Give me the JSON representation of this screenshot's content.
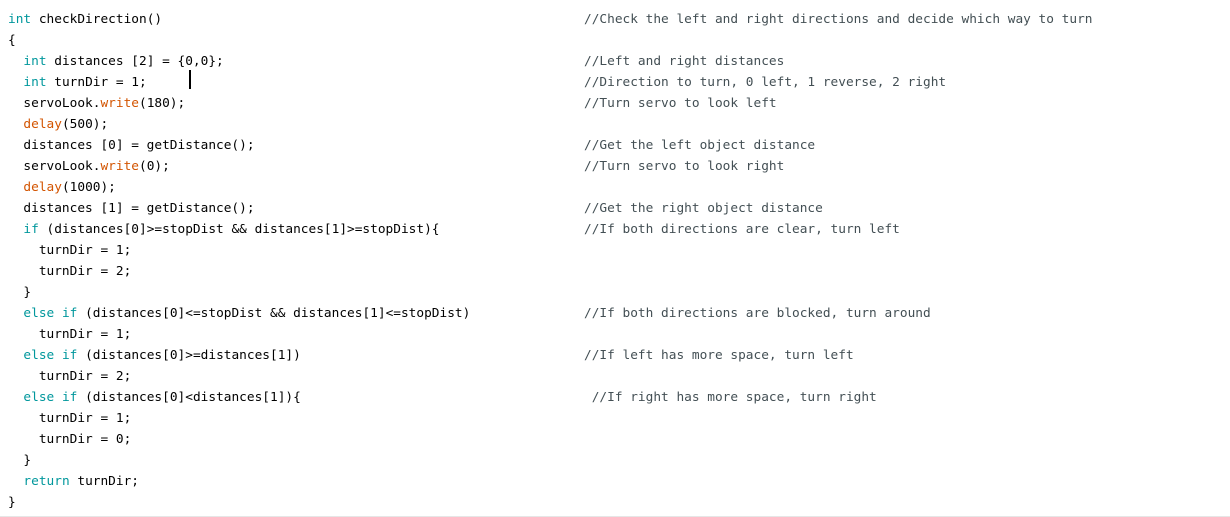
{
  "editor": {
    "lines": [
      {
        "tokens": [
          {
            "t": "int",
            "c": "kw"
          },
          {
            "t": " checkDirection()",
            "c": "plain"
          }
        ],
        "comment": "//Check the left and right directions and decide which way to turn"
      },
      {
        "tokens": [
          {
            "t": "{",
            "c": "plain"
          }
        ],
        "comment": ""
      },
      {
        "tokens": [
          {
            "t": "  ",
            "c": "plain"
          },
          {
            "t": "int",
            "c": "kw"
          },
          {
            "t": " distances [2] = {0,0};",
            "c": "plain"
          }
        ],
        "comment": "//Left and right distances"
      },
      {
        "tokens": [
          {
            "t": "  ",
            "c": "plain"
          },
          {
            "t": "int",
            "c": "kw"
          },
          {
            "t": " turnDir = 1;",
            "c": "plain"
          }
        ],
        "comment": "//Direction to turn, 0 left, 1 reverse, 2 right"
      },
      {
        "tokens": [
          {
            "t": "  servoLook.",
            "c": "plain"
          },
          {
            "t": "write",
            "c": "fn"
          },
          {
            "t": "(180);",
            "c": "plain"
          }
        ],
        "comment": "//Turn servo to look left"
      },
      {
        "tokens": [
          {
            "t": "  ",
            "c": "plain"
          },
          {
            "t": "delay",
            "c": "fn"
          },
          {
            "t": "(500);",
            "c": "plain"
          }
        ],
        "comment": ""
      },
      {
        "tokens": [
          {
            "t": "  distances [0] = getDistance();",
            "c": "plain"
          }
        ],
        "comment": "//Get the left object distance"
      },
      {
        "tokens": [
          {
            "t": "  servoLook.",
            "c": "plain"
          },
          {
            "t": "write",
            "c": "fn"
          },
          {
            "t": "(0);",
            "c": "plain"
          }
        ],
        "comment": "//Turn servo to look right"
      },
      {
        "tokens": [
          {
            "t": "  ",
            "c": "plain"
          },
          {
            "t": "delay",
            "c": "fn"
          },
          {
            "t": "(1000);",
            "c": "plain"
          }
        ],
        "comment": ""
      },
      {
        "tokens": [
          {
            "t": "  distances [1] = getDistance();",
            "c": "plain"
          }
        ],
        "comment": "//Get the right object distance"
      },
      {
        "tokens": [
          {
            "t": "  ",
            "c": "plain"
          },
          {
            "t": "if",
            "c": "kw"
          },
          {
            "t": " (distances[0]>=stopDist && distances[1]>=stopDist){",
            "c": "plain"
          }
        ],
        "comment": "//If both directions are clear, turn left"
      },
      {
        "tokens": [
          {
            "t": "    turnDir = 1;",
            "c": "plain"
          }
        ],
        "comment": ""
      },
      {
        "tokens": [
          {
            "t": "    turnDir = 2;",
            "c": "plain"
          }
        ],
        "comment": ""
      },
      {
        "tokens": [
          {
            "t": "  }",
            "c": "plain"
          }
        ],
        "comment": ""
      },
      {
        "tokens": [
          {
            "t": "  ",
            "c": "plain"
          },
          {
            "t": "else",
            "c": "kw"
          },
          {
            "t": " ",
            "c": "plain"
          },
          {
            "t": "if",
            "c": "kw"
          },
          {
            "t": " (distances[0]<=stopDist && distances[1]<=stopDist)",
            "c": "plain"
          }
        ],
        "comment": "//If both directions are blocked, turn around"
      },
      {
        "tokens": [
          {
            "t": "    turnDir = 1;",
            "c": "plain"
          }
        ],
        "comment": ""
      },
      {
        "tokens": [
          {
            "t": "  ",
            "c": "plain"
          },
          {
            "t": "else",
            "c": "kw"
          },
          {
            "t": " ",
            "c": "plain"
          },
          {
            "t": "if",
            "c": "kw"
          },
          {
            "t": " (distances[0]>=distances[1])",
            "c": "plain"
          }
        ],
        "comment": "//If left has more space, turn left"
      },
      {
        "tokens": [
          {
            "t": "    turnDir = 2;",
            "c": "plain"
          }
        ],
        "comment": ""
      },
      {
        "tokens": [
          {
            "t": "  ",
            "c": "plain"
          },
          {
            "t": "else",
            "c": "kw"
          },
          {
            "t": " ",
            "c": "plain"
          },
          {
            "t": "if",
            "c": "kw"
          },
          {
            "t": " (distances[0]<distances[1]){",
            "c": "plain"
          }
        ],
        "comment": " //If right has more space, turn right"
      },
      {
        "tokens": [
          {
            "t": "    turnDir = 1;",
            "c": "plain"
          }
        ],
        "comment": ""
      },
      {
        "tokens": [
          {
            "t": "    turnDir = 0;",
            "c": "plain"
          }
        ],
        "comment": ""
      },
      {
        "tokens": [
          {
            "t": "  }",
            "c": "plain"
          }
        ],
        "comment": ""
      },
      {
        "tokens": [
          {
            "t": "  ",
            "c": "plain"
          },
          {
            "t": "return",
            "c": "kw"
          },
          {
            "t": " turnDir;",
            "c": "plain"
          }
        ],
        "comment": ""
      },
      {
        "tokens": [
          {
            "t": "}",
            "c": "plain"
          }
        ],
        "comment": ""
      }
    ]
  },
  "colors": {
    "keyword": "#00979c",
    "function": "#d35400",
    "comment": "#434f54",
    "text": "#000000",
    "background": "#ffffff"
  }
}
